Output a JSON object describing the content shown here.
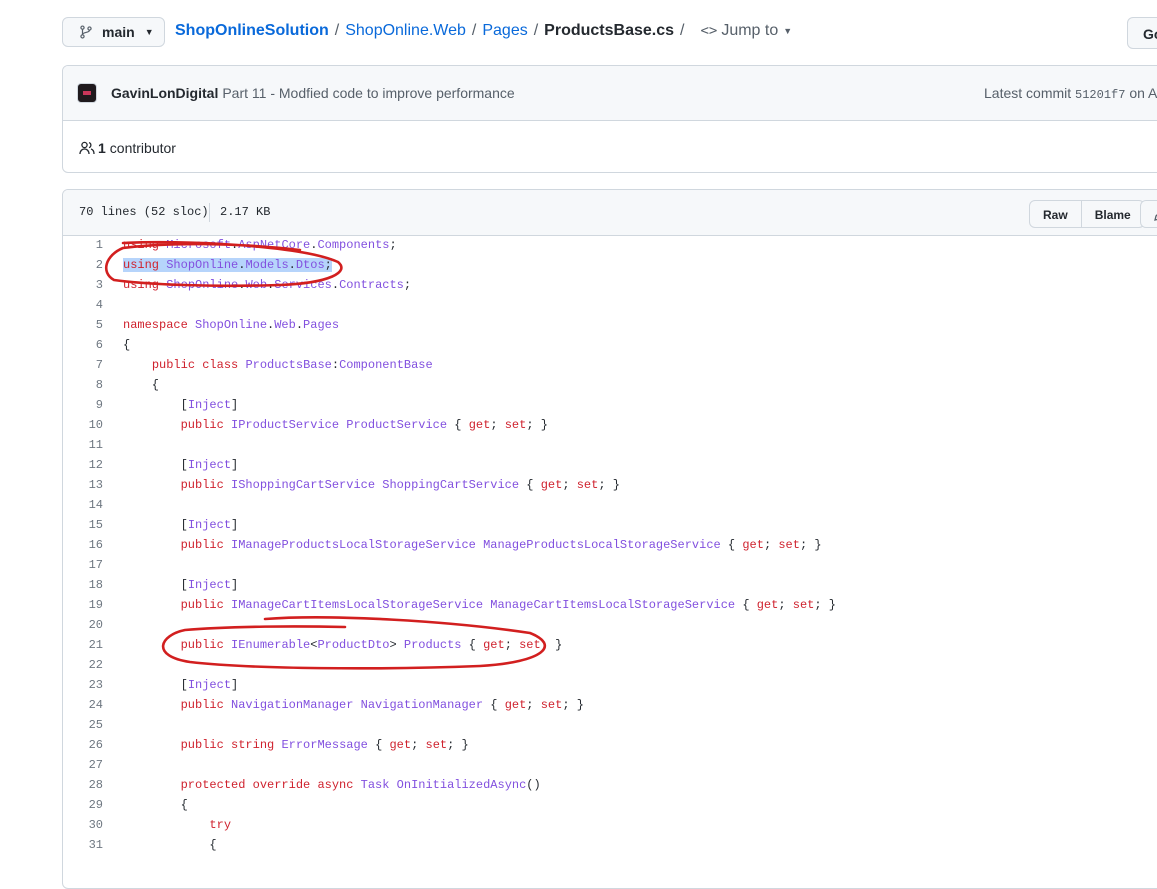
{
  "branch": {
    "label": "main"
  },
  "breadcrumb": {
    "repo": "ShopOnlineSolution",
    "parts": [
      "ShopOnline.Web",
      "Pages"
    ],
    "file": "ProductsBase.cs",
    "jump_label": "Jump to"
  },
  "goto_button": "Go",
  "commit": {
    "author": "GavinLonDigital",
    "message": "Part 11 - Modfied code to improve performance",
    "latest_label": "Latest commit",
    "sha": "51201f7",
    "on_text": "on Ap"
  },
  "contributors": {
    "count": "1",
    "label": "contributor"
  },
  "file_info": {
    "lines": "70 lines (52 sloc)",
    "size": "2.17 KB"
  },
  "file_actions": {
    "raw": "Raw",
    "blame": "Blame"
  },
  "annotation_color": "#d21f1f",
  "code_lines": [
    "using Microsoft.AspNetCore.Components;",
    "using ShopOnline.Models.Dtos;",
    "using ShopOnline.Web.Services.Contracts;",
    "",
    "namespace ShopOnline.Web.Pages",
    "{",
    "    public class ProductsBase:ComponentBase",
    "    {",
    "        [Inject]",
    "        public IProductService ProductService { get; set; }",
    "",
    "        [Inject]",
    "        public IShoppingCartService ShoppingCartService { get; set; }",
    "",
    "        [Inject]",
    "        public IManageProductsLocalStorageService ManageProductsLocalStorageService { get; set; }",
    "",
    "        [Inject]",
    "        public IManageCartItemsLocalStorageService ManageCartItemsLocalStorageService { get; set; }",
    "",
    "        public IEnumerable<ProductDto> Products { get; set; }",
    "",
    "        [Inject]",
    "        public NavigationManager NavigationManager { get; set; }",
    "",
    "        public string ErrorMessage { get; set; }",
    "",
    "        protected override async Task OnInitializedAsync()",
    "        {",
    "            try",
    "            {"
  ]
}
